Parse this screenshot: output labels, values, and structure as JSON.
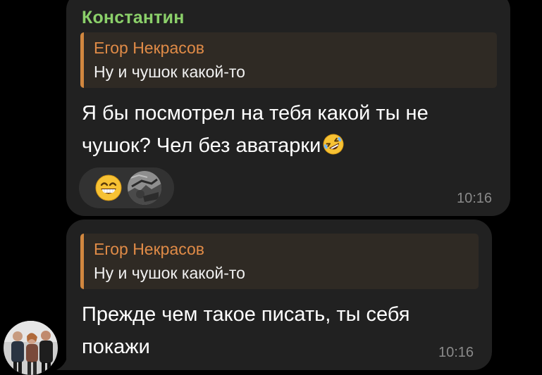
{
  "messages": [
    {
      "sender": "Константин",
      "reply": {
        "name": "Егор Некрасов",
        "text": "Ну и чушок какой-то"
      },
      "text_line1": "Я бы посмотрел на тебя какой ты не",
      "text_line2": "чушок? Чел без аватарки",
      "inline_emoji": "rolling-on-floor-laughing",
      "reactions": [
        {
          "type": "emoji",
          "icon": "grinning-face-with-smiling-eyes"
        },
        {
          "type": "user-avatar",
          "icon": "reactor-avatar"
        }
      ],
      "time": "10:16"
    },
    {
      "reply": {
        "name": "Егор Некрасов",
        "text": "Ну и чушок какой-то"
      },
      "text_line1": "Прежде чем такое писать, ты себя",
      "text_line2": "покажи",
      "time": "10:16"
    }
  ],
  "colors": {
    "background": "#000000",
    "bubble": "#212121",
    "sender_name": "#8bd06a",
    "reply_accent": "#d1873f",
    "reply_background": "#2f2a24",
    "text": "#ffffff",
    "time": "#8a8a8a"
  }
}
